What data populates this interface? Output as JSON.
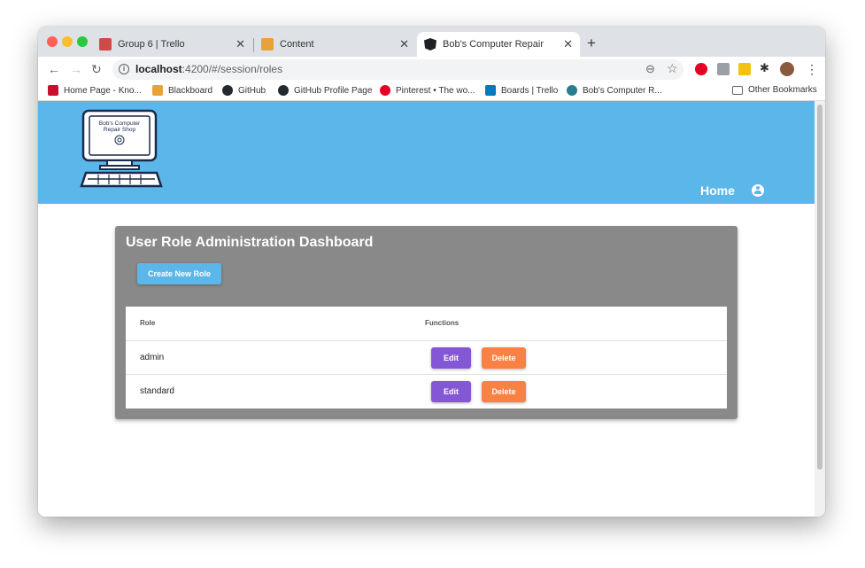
{
  "browser": {
    "tabs": [
      {
        "title": "Group 6 | Trello",
        "favicon_color": "#d04a4a"
      },
      {
        "title": "Content",
        "favicon_color": "#e8a23a"
      },
      {
        "title": "Bob's Computer Repair",
        "favicon_color": "#202124"
      }
    ],
    "url_host": "localhost",
    "url_path": ":4200/#/session/roles",
    "bookmarks": [
      {
        "label": "Home Page - Kno...",
        "color": "#c8102e"
      },
      {
        "label": "Blackboard",
        "color": "#e8a23a"
      },
      {
        "label": "GitHub",
        "color": "#24292e"
      },
      {
        "label": "GitHub Profile Page",
        "color": "#24292e"
      },
      {
        "label": "Pinterest • The wo...",
        "color": "#e60023"
      },
      {
        "label": "Boards | Trello",
        "color": "#0079bf"
      },
      {
        "label": "Bob's Computer R...",
        "color": "#2a7d8c"
      }
    ],
    "other_bookmarks": "Other Bookmarks"
  },
  "header": {
    "logo_line1": "Bob's Computer",
    "logo_line2": "Repair Shop",
    "nav_home": "Home",
    "brand_color": "#5bb7e9"
  },
  "dashboard": {
    "title": "User Role Administration Dashboard",
    "create_label": "Create New Role",
    "columns": [
      "Role",
      "Functions"
    ],
    "rows": [
      {
        "role": "admin",
        "edit_label": "Edit",
        "delete_label": "Delete"
      },
      {
        "role": "standard",
        "edit_label": "Edit",
        "delete_label": "Delete"
      }
    ],
    "edit_color": "#8457d6",
    "delete_color": "#fa8144"
  }
}
